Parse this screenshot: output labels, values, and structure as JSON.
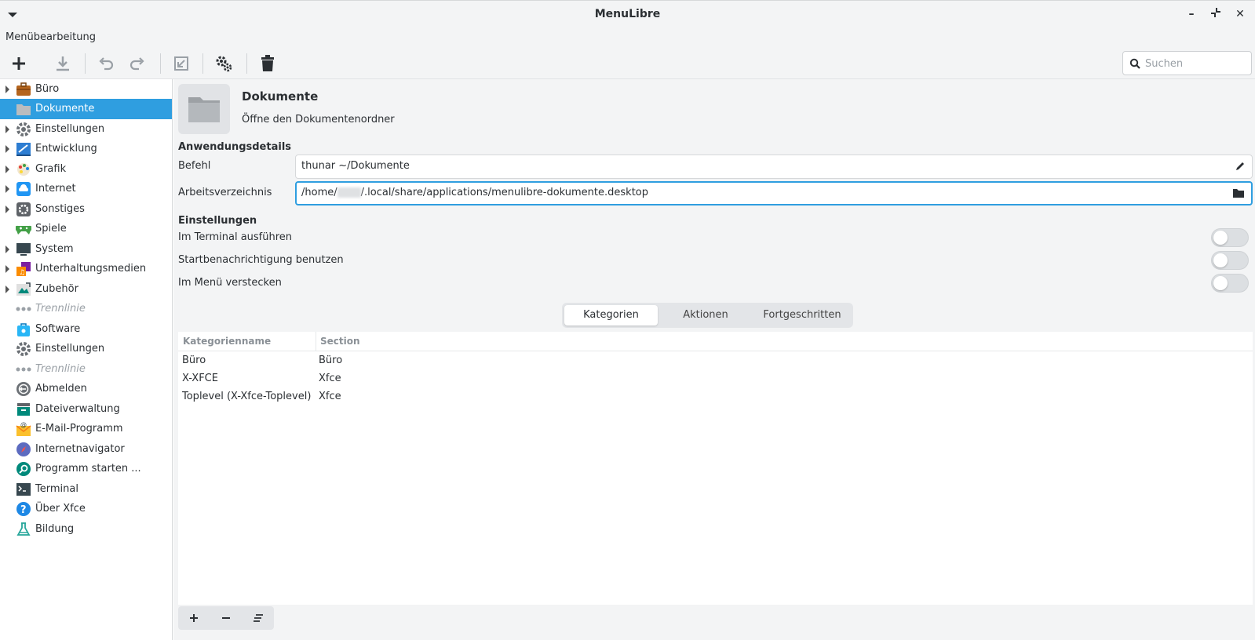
{
  "window": {
    "title": "MenuLibre"
  },
  "menubar": {
    "label": "Menübearbeitung"
  },
  "search": {
    "placeholder": "Suchen"
  },
  "sidebar": {
    "items": [
      {
        "label": "Büro",
        "icon": "briefcase-icon",
        "expandable": true
      },
      {
        "label": "Dokumente",
        "icon": "folder-icon",
        "expandable": false,
        "selected": true
      },
      {
        "label": "Einstellungen",
        "icon": "gear-icon",
        "expandable": true
      },
      {
        "label": "Entwicklung",
        "icon": "development-icon",
        "expandable": true
      },
      {
        "label": "Grafik",
        "icon": "palette-icon",
        "expandable": true
      },
      {
        "label": "Internet",
        "icon": "cloud-icon",
        "expandable": true
      },
      {
        "label": "Sonstiges",
        "icon": "settings-box-icon",
        "expandable": true
      },
      {
        "label": "Spiele",
        "icon": "gamepad-icon",
        "expandable": false
      },
      {
        "label": "System",
        "icon": "monitor-icon",
        "expandable": true
      },
      {
        "label": "Unterhaltungsmedien",
        "icon": "media-icon",
        "expandable": true
      },
      {
        "label": "Zubehör",
        "icon": "accessories-icon",
        "expandable": true
      },
      {
        "label": "Trennlinie",
        "icon": "separator-icon",
        "separator": true
      },
      {
        "label": "Software",
        "icon": "software-bag-icon"
      },
      {
        "label": "Einstellungen",
        "icon": "gear-icon"
      },
      {
        "label": "Trennlinie",
        "icon": "separator-icon",
        "separator": true
      },
      {
        "label": "Abmelden",
        "icon": "logout-icon"
      },
      {
        "label": "Dateiverwaltung",
        "icon": "file-manager-icon"
      },
      {
        "label": "E-Mail-Programm",
        "icon": "mail-icon"
      },
      {
        "label": "Internetnavigator",
        "icon": "compass-icon"
      },
      {
        "label": "Programm starten ...",
        "icon": "app-finder-icon"
      },
      {
        "label": "Terminal",
        "icon": "terminal-icon"
      },
      {
        "label": "Über Xfce",
        "icon": "help-icon"
      },
      {
        "label": "Bildung",
        "icon": "flask-icon"
      }
    ]
  },
  "app": {
    "name": "Dokumente",
    "comment": "Öffne den Dokumentenordner"
  },
  "details": {
    "heading": "Anwendungsdetails",
    "command_label": "Befehl",
    "command_value": "thunar ~/Dokumente",
    "workdir_label": "Arbeitsverzeichnis",
    "workdir_prefix": "/home/",
    "workdir_suffix": "/.local/share/applications/menulibre-dokumente.desktop"
  },
  "settings": {
    "heading": "Einstellungen",
    "options": [
      {
        "label": "Im Terminal ausführen",
        "on": false
      },
      {
        "label": "Startbenachrichtigung benutzen",
        "on": false
      },
      {
        "label": "Im Menü verstecken",
        "on": false
      }
    ]
  },
  "tabs": {
    "categories": "Kategorien",
    "actions": "Aktionen",
    "advanced": "Fortgeschritten"
  },
  "table": {
    "headers": {
      "name": "Kategorienname",
      "section": "Section"
    },
    "rows": [
      {
        "name": "Büro",
        "section": "Büro"
      },
      {
        "name": "X-XFCE",
        "section": "Xfce"
      },
      {
        "name": "Toplevel (X-Xfce-Toplevel)",
        "section": "Xfce"
      }
    ]
  },
  "colors": {
    "accent": "#2f9ee0",
    "background": "#f3f4f5"
  }
}
